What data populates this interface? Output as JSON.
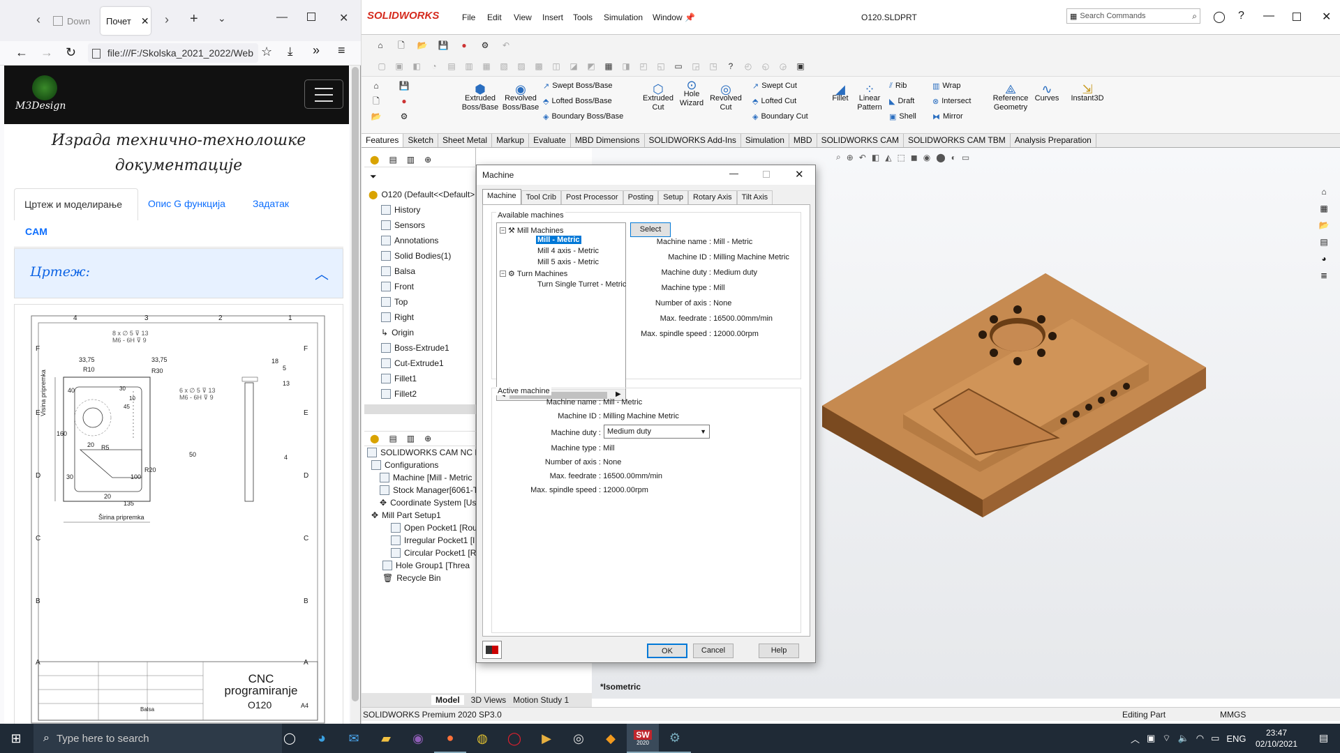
{
  "browser": {
    "tabs": [
      {
        "label": "Down"
      },
      {
        "label": "Почет"
      }
    ],
    "url": "file:///F:/Skolska_2021_2022/Web",
    "site": {
      "logo_text": "M3Design",
      "heading": "Израда технично-технолошке документације",
      "nav": [
        "Цртеж и моделирање",
        "Опис G функција",
        "Задатак",
        "CAM"
      ],
      "section_title": "Цртеж:",
      "drawing": {
        "col_labels": [
          "4",
          "3",
          "2",
          "1"
        ],
        "row_labels": [
          "F",
          "E",
          "D",
          "C",
          "B",
          "A"
        ],
        "dims": [
          "33,75",
          "33,75",
          "8 x ∅ 5 ⊽ 13",
          "M6 - 6H ⊽ 9",
          "R10",
          "R30",
          "6 x ∅ 5 ⊽ 13",
          "M6 - 6H ⊽ 9",
          "40",
          "160",
          "20",
          "R5",
          "R20",
          "30",
          "100",
          "50",
          "20",
          "135",
          "18",
          "5",
          "13",
          "4",
          "10",
          "45",
          "30"
        ],
        "side_label_v": "Visina pripremka",
        "side_label_h": "Širina pripremka",
        "title_block_name": "CNC programiranje",
        "title_block_code": "O120",
        "sheet": "A4",
        "material": "Balsa"
      }
    }
  },
  "solidworks": {
    "brand": "SOLIDWORKS",
    "menus": [
      "File",
      "Edit",
      "View",
      "Insert",
      "Tools",
      "Simulation",
      "Window"
    ],
    "doc_title": "O120.SLDPRT",
    "search_placeholder": "Search Commands",
    "cmd_large": [
      {
        "label": "Extruded Boss/Base"
      },
      {
        "label": "Revolved Boss/Base"
      },
      {
        "label": "Extruded Cut"
      },
      {
        "label": "Hole Wizard"
      },
      {
        "label": "Revolved Cut"
      },
      {
        "label": "Fillet"
      },
      {
        "label": "Linear Pattern"
      },
      {
        "label": "Reference Geometry"
      },
      {
        "label": "Curves"
      },
      {
        "label": "Instant3D"
      }
    ],
    "cmd_small": [
      "Swept Boss/Base",
      "Lofted Boss/Base",
      "Boundary Boss/Base",
      "Swept Cut",
      "Lofted Cut",
      "Boundary Cut",
      "Rib",
      "Draft",
      "Shell",
      "Wrap",
      "Intersect",
      "Mirror"
    ],
    "tabs": [
      "Features",
      "Sketch",
      "Sheet Metal",
      "Markup",
      "Evaluate",
      "MBD Dimensions",
      "SOLIDWORKS Add-Ins",
      "Simulation",
      "MBD",
      "SOLIDWORKS CAM",
      "SOLIDWORKS CAM TBM",
      "Analysis Preparation"
    ],
    "feature_tree": [
      "O120  (Default<<Default>",
      "History",
      "Sensors",
      "Annotations",
      "Solid Bodies(1)",
      "Balsa",
      "Front",
      "Top",
      "Right",
      "Origin",
      "Boss-Extrude1",
      "Cut-Extrude1",
      "Fillet1",
      "Fillet2"
    ],
    "cam_tree": [
      "SOLIDWORKS CAM NC Ma",
      "Configurations",
      "Machine [Mill - Metric",
      "Stock Manager[6061-T",
      "Coordinate System [Us",
      "Mill Part Setup1",
      "Open Pocket1 [Rou",
      "Irregular Pocket1 [I",
      "Circular Pocket1 [R",
      "Hole Group1 [Threa",
      "Recycle Bin"
    ],
    "view_label": "*Isometric",
    "bottom_tabs": [
      "Model",
      "3D Views",
      "Motion Study 1"
    ],
    "status_left": "SOLIDWORKS Premium 2020 SP3.0",
    "status_mid": "Editing Part",
    "status_units": "MMGS"
  },
  "dialog": {
    "title": "Machine",
    "tabs": [
      "Machine",
      "Tool Crib",
      "Post Processor",
      "Posting",
      "Setup",
      "Rotary Axis",
      "Tilt Axis"
    ],
    "available_label": "Available machines",
    "tree": {
      "mill_group": "Mill Machines",
      "mill_items": [
        "Mill - Metric",
        "Mill 4 axis - Metric",
        "Mill 5 axis - Metric"
      ],
      "turn_group": "Turn Machines",
      "turn_items": [
        "Turn Single Turret - Metric"
      ]
    },
    "select_label": "Select",
    "avail_props": [
      {
        "k": "Machine name :",
        "v": "Mill - Metric"
      },
      {
        "k": "Machine ID :",
        "v": "Milling Machine Metric"
      },
      {
        "k": "Machine duty :",
        "v": "Medium duty"
      },
      {
        "k": "Machine type :",
        "v": "Mill"
      },
      {
        "k": "Number of axis :",
        "v": "None"
      },
      {
        "k": "Max. feedrate :",
        "v": "16500.00mm/min"
      },
      {
        "k": "Max. spindle speed :",
        "v": "12000.00rpm"
      }
    ],
    "active_label": "Active machine",
    "active_props": [
      {
        "k": "Machine name :",
        "v": "Mill - Metric"
      },
      {
        "k": "Machine ID :",
        "v": "Milling Machine Metric"
      },
      {
        "k": "Machine duty :",
        "v": "Medium duty"
      },
      {
        "k": "Machine type :",
        "v": "Mill"
      },
      {
        "k": "Number of axis :",
        "v": "None"
      },
      {
        "k": "Max. feedrate :",
        "v": "16500.00mm/min"
      },
      {
        "k": "Max. spindle speed :",
        "v": "12000.00rpm"
      }
    ],
    "ok": "OK",
    "cancel": "Cancel",
    "help": "Help"
  },
  "taskbar": {
    "search_placeholder": "Type here to search",
    "lang": "ENG",
    "time": "23:47",
    "date": "02/10/2021",
    "sw_badge": "2020"
  }
}
